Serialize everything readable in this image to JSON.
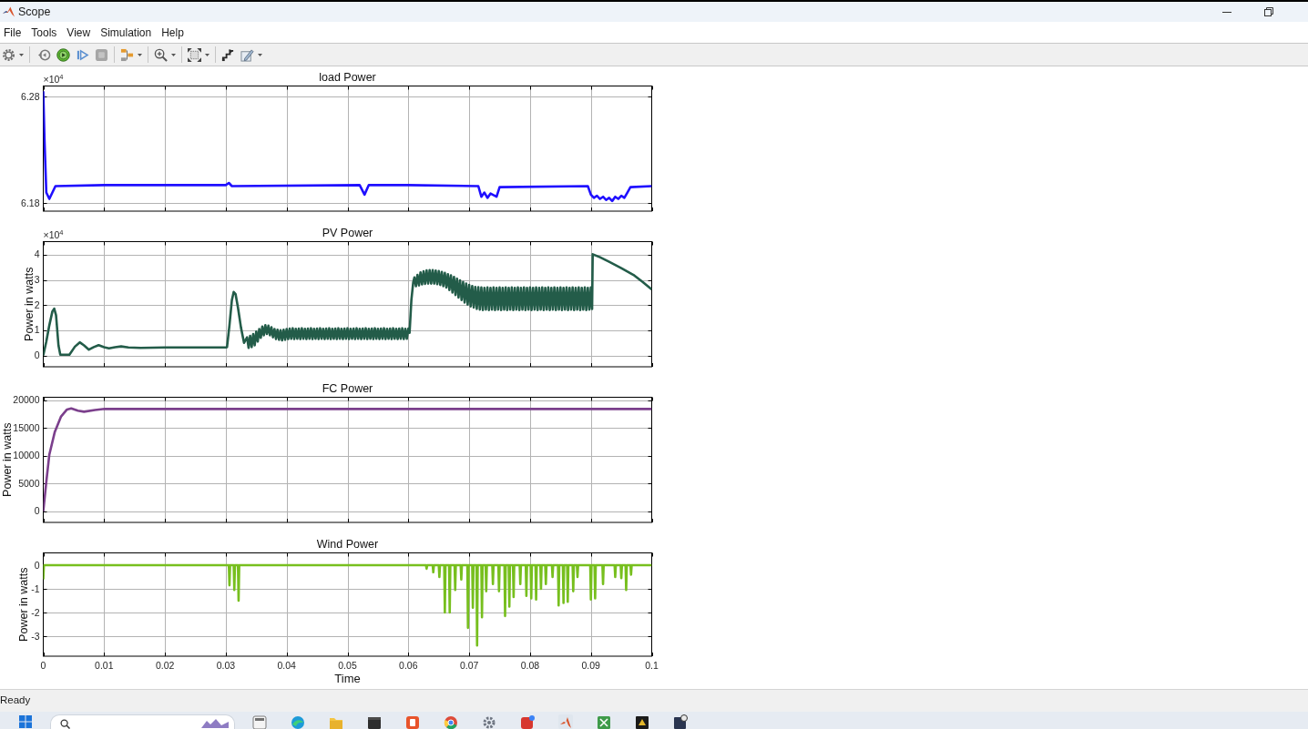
{
  "window": {
    "title": "Scope"
  },
  "menu": [
    "File",
    "Tools",
    "View",
    "Simulation",
    "Help"
  ],
  "toolbar": {
    "stop": {
      "disabled": true
    }
  },
  "plots": [
    {
      "multiplier": {
        "base": "×10",
        "exponent": "4"
      },
      "chart_data": {
        "type": "line",
        "title": "load Power",
        "grid": true,
        "xlim": [
          0,
          0.1
        ],
        "ylim": [
          6.1725,
          6.29
        ],
        "yticks": [
          {
            "value": 6.18,
            "label": "6.18"
          },
          {
            "value": 6.28,
            "label": "6.28"
          }
        ],
        "x": [
          0,
          0.0002,
          0.0005,
          0.001,
          0.0015,
          0.002,
          0.01,
          0.03,
          0.0305,
          0.031,
          0.052,
          0.0528,
          0.0535,
          0.06,
          0.0715,
          0.072,
          0.0725,
          0.073,
          0.0735,
          0.0745,
          0.075,
          0.0895,
          0.09,
          0.0905,
          0.091,
          0.0915,
          0.092,
          0.0925,
          0.093,
          0.0935,
          0.094,
          0.0945,
          0.095,
          0.0955,
          0.096,
          0.0965,
          0.1
        ],
        "series": [
          {
            "color": "#1f0fff",
            "values": [
              6.285,
              6.24,
              6.19,
              6.184,
              6.19,
              6.196,
              6.197,
              6.197,
              6.199,
              6.196,
              6.197,
              6.188,
              6.197,
              6.197,
              6.196,
              6.186,
              6.19,
              6.185,
              6.189,
              6.186,
              6.195,
              6.196,
              6.188,
              6.185,
              6.187,
              6.184,
              6.186,
              6.183,
              6.185,
              6.182,
              6.186,
              6.184,
              6.187,
              6.185,
              6.19,
              6.195,
              6.196
            ]
          }
        ]
      }
    },
    {
      "multiplier": {
        "base": "×10",
        "exponent": "4"
      },
      "chart_data": {
        "type": "line",
        "title": "PV Power",
        "ylabel": "Power in watts",
        "grid": true,
        "xlim": [
          0,
          0.1
        ],
        "ylim": [
          -0.45,
          4.52
        ],
        "yticks": [
          {
            "value": 0,
            "label": "0"
          },
          {
            "value": 1,
            "label": "1"
          },
          {
            "value": 2,
            "label": "2"
          },
          {
            "value": 3,
            "label": "3"
          },
          {
            "value": 4,
            "label": "4"
          }
        ],
        "x": [
          0,
          0.0005,
          0.001,
          0.0015,
          0.0018,
          0.0021,
          0.0025,
          0.0028,
          0.0043,
          0.0052,
          0.006,
          0.0067,
          0.0075,
          0.0083,
          0.0091,
          0.01,
          0.0108,
          0.0118,
          0.0128,
          0.014,
          0.016,
          0.02,
          0.03,
          0.0302,
          0.0306,
          0.031,
          0.0313,
          0.0316,
          0.032,
          0.0325,
          0.033,
          0.0335,
          0.03375,
          0.034,
          0.03425,
          0.0345,
          0.03475,
          0.035,
          0.03525,
          0.0355,
          0.03575,
          0.036,
          0.03625,
          0.0365,
          0.03675,
          0.037,
          0.03725,
          0.0375,
          0.03775,
          0.038,
          0.03825,
          0.0385,
          0.03875,
          0.039,
          0.03925,
          0.0395,
          0.03975,
          0.04,
          0.04025,
          0.0405,
          0.04075,
          0.041,
          0.04125,
          0.0415,
          0.04175,
          0.042,
          0.04225,
          0.0425,
          0.04275,
          0.043,
          0.04325,
          0.0435,
          0.04375,
          0.044,
          0.04425,
          0.0445,
          0.04475,
          0.045,
          0.04525,
          0.0455,
          0.04575,
          0.046,
          0.04625,
          0.0465,
          0.04675,
          0.047,
          0.04725,
          0.0475,
          0.04775,
          0.048,
          0.04825,
          0.0485,
          0.04875,
          0.049,
          0.04925,
          0.0495,
          0.04975,
          0.05,
          0.05025,
          0.0505,
          0.05075,
          0.051,
          0.05125,
          0.0515,
          0.05175,
          0.052,
          0.05225,
          0.0525,
          0.05275,
          0.053,
          0.05325,
          0.0535,
          0.05375,
          0.054,
          0.05425,
          0.0545,
          0.05475,
          0.055,
          0.05525,
          0.0555,
          0.05575,
          0.056,
          0.05625,
          0.0565,
          0.05675,
          0.057,
          0.05725,
          0.0575,
          0.05775,
          0.058,
          0.05825,
          0.0585,
          0.05875,
          0.059,
          0.05925,
          0.0595,
          0.05975,
          0.06,
          0.0602,
          0.0605,
          0.0608,
          0.061,
          0.06125,
          0.0615,
          0.06175,
          0.062,
          0.06225,
          0.0625,
          0.06275,
          0.063,
          0.06325,
          0.0635,
          0.06375,
          0.064,
          0.06425,
          0.0645,
          0.06475,
          0.065,
          0.06525,
          0.0655,
          0.06575,
          0.066,
          0.06625,
          0.0665,
          0.06675,
          0.067,
          0.06725,
          0.0675,
          0.06775,
          0.068,
          0.06825,
          0.0685,
          0.06875,
          0.069,
          0.06925,
          0.0695,
          0.06975,
          0.07,
          0.07025,
          0.0705,
          0.07075,
          0.071,
          0.07125,
          0.0715,
          0.07175,
          0.072,
          0.07225,
          0.0725,
          0.07275,
          0.073,
          0.07325,
          0.0735,
          0.07375,
          0.074,
          0.07425,
          0.0745,
          0.07475,
          0.075,
          0.07525,
          0.0755,
          0.07575,
          0.076,
          0.07625,
          0.0765,
          0.07675,
          0.077,
          0.07725,
          0.0775,
          0.07775,
          0.078,
          0.07825,
          0.0785,
          0.07875,
          0.079,
          0.07925,
          0.0795,
          0.07975,
          0.08,
          0.08025,
          0.0805,
          0.08075,
          0.081,
          0.08125,
          0.0815,
          0.08175,
          0.082,
          0.08225,
          0.0825,
          0.08275,
          0.083,
          0.08325,
          0.0835,
          0.08375,
          0.084,
          0.08425,
          0.0845,
          0.08475,
          0.085,
          0.08525,
          0.0855,
          0.08575,
          0.086,
          0.08625,
          0.0865,
          0.08675,
          0.087,
          0.08725,
          0.0875,
          0.08775,
          0.088,
          0.08825,
          0.0885,
          0.08875,
          0.089,
          0.08925,
          0.0895,
          0.08975,
          0.09,
          0.0902,
          0.0903,
          0.0915,
          0.093,
          0.095,
          0.097,
          0.0985,
          0.1
        ],
        "series": [
          {
            "color": "#235c49",
            "values": [
              0,
              0.55,
              1.2,
              1.75,
              1.86,
              1.6,
              0.4,
              0.03,
              0.03,
              0.35,
              0.52,
              0.4,
              0.23,
              0.33,
              0.41,
              0.33,
              0.28,
              0.33,
              0.36,
              0.32,
              0.3,
              0.32,
              0.32,
              0.33,
              1.2,
              2.2,
              2.52,
              2.44,
              1.9,
              1.1,
              0.5,
              0.72,
              0.3,
              0.78,
              0.33,
              0.85,
              0.4,
              0.95,
              0.55,
              1.05,
              0.7,
              1.15,
              0.8,
              1.2,
              0.85,
              1.18,
              0.8,
              1.12,
              0.72,
              1.05,
              0.65,
              1.02,
              0.62,
              1.0,
              0.6,
              1.02,
              0.62,
              1.05,
              0.65,
              1.07,
              0.66,
              1.08,
              0.65,
              1.06,
              0.66,
              1.07,
              0.65,
              1.08,
              0.66,
              1.06,
              0.65,
              1.07,
              0.66,
              1.08,
              0.65,
              1.06,
              0.66,
              1.07,
              0.65,
              1.08,
              0.66,
              1.06,
              0.65,
              1.07,
              0.66,
              1.08,
              0.65,
              1.06,
              0.66,
              1.07,
              0.65,
              1.08,
              0.66,
              1.06,
              0.65,
              1.07,
              0.66,
              1.08,
              0.65,
              1.06,
              0.66,
              1.07,
              0.65,
              1.08,
              0.66,
              1.06,
              0.65,
              1.07,
              0.66,
              1.08,
              0.65,
              1.06,
              0.66,
              1.07,
              0.65,
              1.08,
              0.66,
              1.06,
              0.65,
              1.07,
              0.66,
              1.08,
              0.65,
              1.06,
              0.66,
              1.07,
              0.65,
              1.08,
              0.66,
              1.06,
              0.65,
              1.07,
              0.66,
              1.08,
              0.65,
              1.06,
              0.66,
              1.07,
              0.9,
              2.2,
              2.9,
              3.1,
              2.75,
              3.2,
              2.78,
              3.3,
              2.82,
              3.34,
              2.84,
              3.38,
              2.85,
              3.39,
              2.85,
              3.39,
              2.85,
              3.37,
              2.83,
              3.35,
              2.8,
              3.32,
              2.75,
              3.28,
              2.7,
              3.23,
              2.6,
              3.18,
              2.5,
              3.12,
              2.4,
              3.05,
              2.3,
              2.98,
              2.2,
              2.92,
              2.1,
              2.86,
              2.02,
              2.8,
              1.95,
              2.76,
              1.9,
              2.72,
              1.85,
              2.71,
              1.82,
              2.7,
              1.8,
              2.68,
              1.82,
              2.7,
              1.8,
              2.68,
              1.82,
              2.7,
              1.8,
              2.68,
              1.82,
              2.7,
              1.8,
              2.68,
              1.82,
              2.7,
              1.8,
              2.68,
              1.82,
              2.7,
              1.8,
              2.68,
              1.82,
              2.7,
              1.8,
              2.68,
              1.82,
              2.7,
              1.8,
              2.68,
              1.82,
              2.7,
              1.8,
              2.68,
              1.82,
              2.7,
              1.8,
              2.68,
              1.82,
              2.7,
              1.8,
              2.68,
              1.82,
              2.7,
              1.8,
              2.68,
              1.82,
              2.7,
              1.8,
              2.68,
              1.82,
              2.7,
              1.8,
              2.68,
              1.82,
              2.7,
              1.8,
              2.68,
              1.82,
              2.7,
              1.8,
              2.68,
              1.82,
              2.7,
              1.8,
              2.68,
              1.82,
              2.7,
              1.8,
              2.68,
              1.82,
              2.7,
              1.85,
              4.02,
              3.9,
              3.72,
              3.47,
              3.2,
              2.92,
              2.62
            ]
          }
        ]
      }
    },
    {
      "chart_data": {
        "type": "line",
        "title": "FC Power",
        "ylabel": "Power in watts",
        "grid": true,
        "xlim": [
          0,
          0.1
        ],
        "ylim": [
          -2000,
          20500
        ],
        "yticks": [
          {
            "value": 0,
            "label": "0"
          },
          {
            "value": 5000,
            "label": "5000"
          },
          {
            "value": 10000,
            "label": "10000"
          },
          {
            "value": 15000,
            "label": "15000"
          },
          {
            "value": 20000,
            "label": "20000"
          }
        ],
        "x": [
          0,
          0.0005,
          0.001,
          0.0019,
          0.0029,
          0.0039,
          0.0046,
          0.0057,
          0.0067,
          0.0085,
          0.0101,
          0.015,
          0.02,
          0.05,
          0.1
        ],
        "series": [
          {
            "color": "#7b3f8c",
            "values": [
              0,
              5300,
              10200,
              14300,
              17000,
              18300,
              18500,
              18100,
              17900,
              18200,
              18400,
              18400,
              18400,
              18400,
              18400
            ]
          }
        ]
      }
    },
    {
      "chart_data": {
        "type": "line",
        "title": "Wind  Power",
        "xlabel": "Time",
        "ylabel": "Power in watts",
        "grid": true,
        "xlim": [
          0,
          0.1
        ],
        "ylim": [
          -3.85,
          0.52
        ],
        "xticks": [
          {
            "value": 0,
            "label": "0"
          },
          {
            "value": 0.01,
            "label": "0.01"
          },
          {
            "value": 0.02,
            "label": "0.02"
          },
          {
            "value": 0.03,
            "label": "0.03"
          },
          {
            "value": 0.04,
            "label": "0.04"
          },
          {
            "value": 0.05,
            "label": "0.05"
          },
          {
            "value": 0.06,
            "label": "0.06"
          },
          {
            "value": 0.07,
            "label": "0.07"
          },
          {
            "value": 0.08,
            "label": "0.08"
          },
          {
            "value": 0.09,
            "label": "0.09"
          },
          {
            "value": 0.1,
            "label": "0.1"
          }
        ],
        "yticks": [
          {
            "value": -3,
            "label": "-3"
          },
          {
            "value": -2,
            "label": "-2"
          },
          {
            "value": -1,
            "label": "-1"
          },
          {
            "value": 0,
            "label": "0"
          }
        ],
        "x": [
          0,
          0.0001,
          0.0305,
          0.0306,
          0.0307,
          0.0313,
          0.0314,
          0.0315,
          0.032,
          0.0321,
          0.0322,
          0.0629,
          0.063,
          0.0631,
          0.064,
          0.0641,
          0.0642,
          0.065,
          0.0651,
          0.0652,
          0.0659,
          0.066,
          0.0661,
          0.0667,
          0.0668,
          0.0669,
          0.0676,
          0.0677,
          0.0678,
          0.0686,
          0.0687,
          0.0688,
          0.0697,
          0.0698,
          0.0699,
          0.0705,
          0.0706,
          0.0707,
          0.0712,
          0.0713,
          0.0714,
          0.072,
          0.0721,
          0.0722,
          0.0727,
          0.0728,
          0.0729,
          0.0738,
          0.0739,
          0.074,
          0.0748,
          0.0749,
          0.075,
          0.0758,
          0.0759,
          0.076,
          0.0765,
          0.0766,
          0.0767,
          0.0772,
          0.0773,
          0.0774,
          0.0783,
          0.0784,
          0.0785,
          0.0793,
          0.0794,
          0.0795,
          0.0801,
          0.0802,
          0.0803,
          0.0809,
          0.081,
          0.0811,
          0.0817,
          0.0818,
          0.0819,
          0.0825,
          0.0826,
          0.0827,
          0.0836,
          0.0837,
          0.0838,
          0.0846,
          0.0847,
          0.0848,
          0.0854,
          0.0855,
          0.0856,
          0.0861,
          0.0862,
          0.0863,
          0.087,
          0.0871,
          0.0872,
          0.0877,
          0.0878,
          0.0879,
          0.0899,
          0.09,
          0.0901,
          0.0906,
          0.0907,
          0.0908,
          0.0919,
          0.092,
          0.0921,
          0.0939,
          0.094,
          0.0941,
          0.0949,
          0.095,
          0.0951,
          0.0957,
          0.0958,
          0.0959,
          0.0965,
          0.0966,
          0.0967,
          0.1
        ],
        "series": [
          {
            "color": "#77bf1e",
            "values": [
              -0.6,
              0,
              0,
              -0.85,
              0,
              0,
              -1.05,
              0,
              0,
              -1.5,
              0,
              0,
              -0.15,
              0,
              0,
              -0.3,
              0,
              0,
              -0.5,
              0,
              0,
              -2.0,
              0,
              0,
              -2.0,
              0,
              0,
              -1.05,
              0,
              0,
              -0.6,
              0,
              0,
              -2.65,
              0,
              0,
              -1.8,
              0,
              0,
              -3.4,
              0,
              0,
              -2.2,
              0,
              0,
              -1.1,
              0,
              0,
              -0.8,
              0,
              0,
              -1.1,
              0,
              0,
              -2.15,
              0,
              0,
              -1.75,
              0,
              0,
              -1.35,
              0,
              0,
              -0.8,
              0,
              0,
              -1.3,
              0,
              0,
              -1.4,
              0,
              0,
              -1.45,
              0,
              0,
              -1.0,
              0,
              0,
              -0.8,
              0,
              0,
              -0.5,
              0,
              0,
              -1.7,
              0,
              0,
              -1.6,
              0,
              0,
              -1.55,
              0,
              0,
              -1.1,
              0,
              0,
              -0.5,
              0,
              0,
              -1.45,
              0,
              0,
              -1.4,
              0,
              0,
              -0.8,
              0,
              0,
              -0.5,
              0,
              0,
              -0.55,
              0,
              0,
              -1.05,
              0,
              0,
              -0.4,
              0,
              0
            ]
          }
        ]
      }
    }
  ],
  "status_bar": {
    "text": "Ready"
  }
}
